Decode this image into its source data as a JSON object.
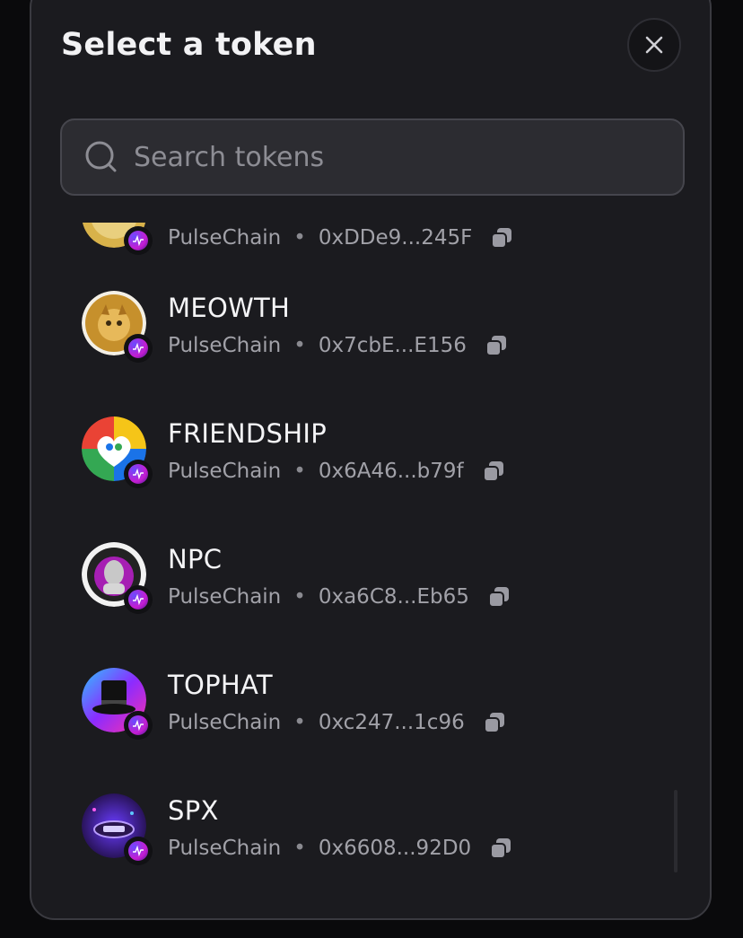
{
  "modal": {
    "title": "Select a token",
    "close_icon": "close-icon"
  },
  "search": {
    "placeholder": "Search tokens",
    "value": "",
    "icon": "search-icon"
  },
  "tokens": [
    {
      "name": "",
      "chain": "PulseChain",
      "separator": "•",
      "address": "0xDDe9...245F",
      "avatar": "gold-coin-icon"
    },
    {
      "name": "MEOWTH",
      "chain": "PulseChain",
      "separator": "•",
      "address": "0x7cbE...E156",
      "avatar": "meowth-icon"
    },
    {
      "name": "FRIENDSHIP",
      "chain": "PulseChain",
      "separator": "•",
      "address": "0x6A46...b79f",
      "avatar": "friendship-heart-icon"
    },
    {
      "name": "NPC",
      "chain": "PulseChain",
      "separator": "•",
      "address": "0xa6C8...Eb65",
      "avatar": "npc-face-icon"
    },
    {
      "name": "TOPHAT",
      "chain": "PulseChain",
      "separator": "•",
      "address": "0xc247...1c96",
      "avatar": "top-hat-icon"
    },
    {
      "name": "SPX",
      "chain": "PulseChain",
      "separator": "•",
      "address": "0x6608...92D0",
      "avatar": "spx-icon"
    }
  ],
  "colors": {
    "background": "#1b1b1f",
    "border": "#3a3a40",
    "text_primary": "#f4f4f6",
    "text_secondary": "#a1a1a8",
    "chain_badge": "#c51dd1"
  }
}
